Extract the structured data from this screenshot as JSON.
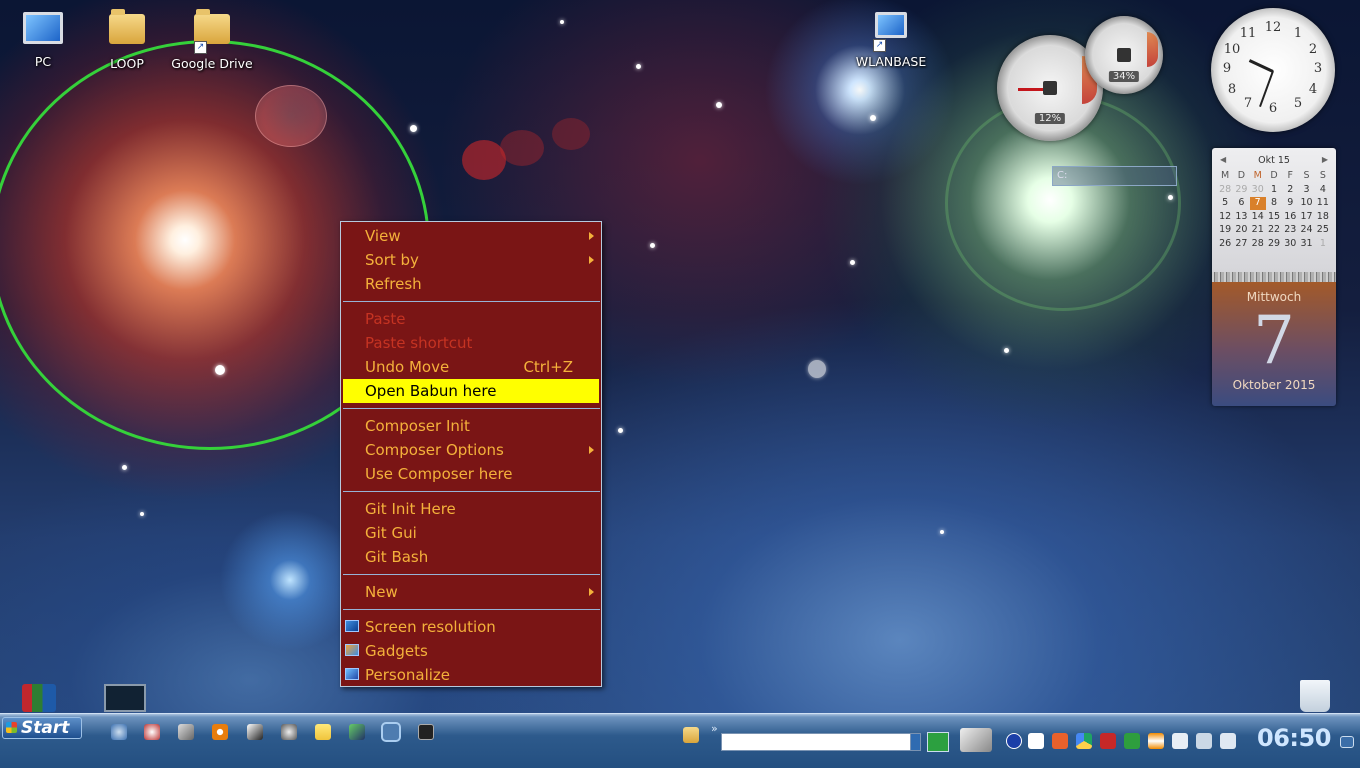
{
  "desktop": {
    "icons": [
      {
        "label": "PC",
        "icon": "computer-icon"
      },
      {
        "label": "LOOP",
        "icon": "user-folder-icon"
      },
      {
        "label": "Google Drive",
        "icon": "google-drive-folder-icon"
      },
      {
        "label": "WLANBASE",
        "icon": "network-computers-icon"
      }
    ]
  },
  "context_menu": {
    "items": [
      {
        "label": "View",
        "submenu": true
      },
      {
        "label": "Sort by",
        "submenu": true
      },
      {
        "label": "Refresh"
      },
      {
        "label": "Paste",
        "disabled": true
      },
      {
        "label": "Paste shortcut",
        "disabled": true
      },
      {
        "label": "Undo Move",
        "shortcut": "Ctrl+Z"
      },
      {
        "label": "Open Babun here",
        "highlighted": true
      },
      {
        "label": "Composer Init"
      },
      {
        "label": "Composer Options",
        "submenu": true
      },
      {
        "label": "Use Composer here"
      },
      {
        "label": "Git Init Here"
      },
      {
        "label": "Git Gui"
      },
      {
        "label": "Git Bash"
      },
      {
        "label": "New",
        "submenu": true
      },
      {
        "label": "Screen resolution",
        "icon": "screen-resolution-icon"
      },
      {
        "label": "Gadgets",
        "icon": "gadgets-icon"
      },
      {
        "label": "Personalize",
        "icon": "personalize-icon"
      }
    ]
  },
  "gadgets": {
    "cpu_gauge": {
      "value": "12%"
    },
    "memory_gauge": {
      "value": "34%"
    },
    "drive_meter": {
      "label": "C:"
    },
    "clock": {
      "numbers": [
        "12",
        "1",
        "2",
        "3",
        "4",
        "5",
        "6",
        "7",
        "8",
        "9",
        "10",
        "11"
      ],
      "time": "06:50"
    },
    "calendar": {
      "month_label": "Okt 15",
      "weekday_headers": [
        "M",
        "D",
        "M",
        "D",
        "F",
        "S",
        "S"
      ],
      "weeks": [
        [
          "28",
          "29",
          "30",
          "1",
          "2",
          "3",
          "4"
        ],
        [
          "5",
          "6",
          "7",
          "8",
          "9",
          "10",
          "11"
        ],
        [
          "12",
          "13",
          "14",
          "15",
          "16",
          "17",
          "18"
        ],
        [
          "19",
          "20",
          "21",
          "22",
          "23",
          "24",
          "25"
        ],
        [
          "26",
          "27",
          "28",
          "29",
          "30",
          "31",
          "1"
        ]
      ],
      "today": "7",
      "weekday_name": "Mittwoch",
      "day": "7",
      "month_year": "Oktober 2015"
    }
  },
  "taskbar": {
    "start_label": "Start",
    "clock": "06:50",
    "chevron": "»",
    "colors": {
      "accent": "#244f80",
      "clock_text": "#cfe6ff"
    }
  },
  "colors": {
    "menu_bg": "#7a1515",
    "menu_text": "#f4b13b",
    "menu_disabled": "#c53322",
    "menu_highlight": "#ffff00",
    "ring": "#35d13a"
  }
}
